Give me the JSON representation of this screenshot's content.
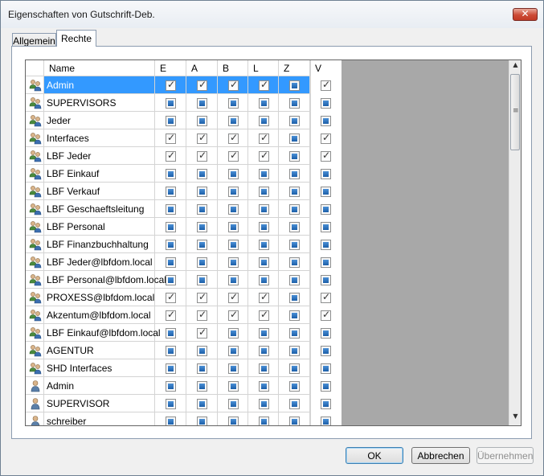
{
  "window": {
    "title": "Eigenschaften von Gutschrift-Deb.",
    "close_label": "✕"
  },
  "tabs": [
    {
      "label": "Allgemein",
      "active": false
    },
    {
      "label": "Rechte",
      "active": true
    }
  ],
  "grid": {
    "columns": [
      "Name",
      "E",
      "A",
      "B",
      "L",
      "Z",
      "V"
    ],
    "rows": [
      {
        "type": "group",
        "name": "Admin",
        "selected": true,
        "perms": [
          "checked",
          "checked",
          "checked",
          "checked",
          "indet",
          "checked"
        ]
      },
      {
        "type": "group",
        "name": "SUPERVISORS",
        "perms": [
          "indet",
          "indet",
          "indet",
          "indet",
          "indet",
          "indet"
        ]
      },
      {
        "type": "group",
        "name": "Jeder",
        "perms": [
          "indet",
          "indet",
          "indet",
          "indet",
          "indet",
          "indet"
        ]
      },
      {
        "type": "group",
        "name": "Interfaces",
        "perms": [
          "checked",
          "checked",
          "checked",
          "checked",
          "indet",
          "checked"
        ]
      },
      {
        "type": "group",
        "name": "LBF Jeder",
        "perms": [
          "checked",
          "checked",
          "checked",
          "checked",
          "indet",
          "checked"
        ]
      },
      {
        "type": "group",
        "name": "LBF Einkauf",
        "perms": [
          "indet",
          "indet",
          "indet",
          "indet",
          "indet",
          "indet"
        ]
      },
      {
        "type": "group",
        "name": "LBF Verkauf",
        "perms": [
          "indet",
          "indet",
          "indet",
          "indet",
          "indet",
          "indet"
        ]
      },
      {
        "type": "group",
        "name": "LBF Geschaeftsleitung",
        "perms": [
          "indet",
          "indet",
          "indet",
          "indet",
          "indet",
          "indet"
        ]
      },
      {
        "type": "group",
        "name": "LBF Personal",
        "perms": [
          "indet",
          "indet",
          "indet",
          "indet",
          "indet",
          "indet"
        ]
      },
      {
        "type": "group",
        "name": "LBF Finanzbuchhaltung",
        "perms": [
          "indet",
          "indet",
          "indet",
          "indet",
          "indet",
          "indet"
        ]
      },
      {
        "type": "group",
        "name": "LBF Jeder@lbfdom.local",
        "perms": [
          "indet",
          "indet",
          "indet",
          "indet",
          "indet",
          "indet"
        ]
      },
      {
        "type": "group",
        "name": "LBF Personal@lbfdom.local",
        "perms": [
          "indet",
          "indet",
          "indet",
          "indet",
          "indet",
          "indet"
        ]
      },
      {
        "type": "group",
        "name": "PROXESS@lbfdom.local",
        "perms": [
          "checked",
          "checked",
          "checked",
          "checked",
          "indet",
          "checked"
        ]
      },
      {
        "type": "group",
        "name": "Akzentum@lbfdom.local",
        "perms": [
          "checked",
          "checked",
          "checked",
          "checked",
          "indet",
          "checked"
        ]
      },
      {
        "type": "group",
        "name": "LBF Einkauf@lbfdom.local",
        "perms": [
          "indet",
          "checked",
          "indet",
          "indet",
          "indet",
          "indet"
        ]
      },
      {
        "type": "group",
        "name": "AGENTUR",
        "perms": [
          "indet",
          "indet",
          "indet",
          "indet",
          "indet",
          "indet"
        ]
      },
      {
        "type": "group",
        "name": "SHD Interfaces",
        "perms": [
          "indet",
          "indet",
          "indet",
          "indet",
          "indet",
          "indet"
        ]
      },
      {
        "type": "user",
        "name": "Admin",
        "perms": [
          "indet",
          "indet",
          "indet",
          "indet",
          "indet",
          "indet"
        ]
      },
      {
        "type": "user",
        "name": "SUPERVISOR",
        "perms": [
          "indet",
          "indet",
          "indet",
          "indet",
          "indet",
          "indet"
        ]
      },
      {
        "type": "user",
        "name": "schreiber",
        "perms": [
          "indet",
          "indet",
          "indet",
          "indet",
          "indet",
          "indet"
        ]
      }
    ]
  },
  "scrollbar": {
    "up": "▲",
    "down": "▼",
    "grip": "≡"
  },
  "buttons": {
    "ok": "OK",
    "cancel": "Abbrechen",
    "apply": "Übernehmen"
  }
}
